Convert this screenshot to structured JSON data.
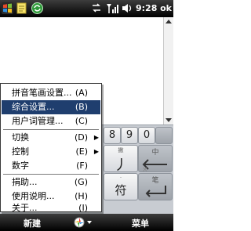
{
  "status_bar": {
    "time": "9:28",
    "ok_label": "ok",
    "icons": [
      "windows-start-icon",
      "notes-icon",
      "sync-icon",
      "connectivity-icon",
      "signal-icon",
      "volume-icon"
    ]
  },
  "keyboard": {
    "keys": [
      {
        "name": "key-8",
        "label": "8"
      },
      {
        "name": "key-9",
        "label": "9"
      },
      {
        "name": "key-0",
        "label": "0"
      },
      {
        "name": "key-ji",
        "label": "丿",
        "sub": "撇"
      },
      {
        "name": "key-fu",
        "label": "符"
      },
      {
        "name": "key-bi",
        "label": "笔"
      },
      {
        "name": "key-zhong",
        "label": "中"
      }
    ]
  },
  "menu": {
    "items": [
      {
        "label": "拼音笔画设置...",
        "accel": "(A)"
      },
      {
        "label": "综合设置...",
        "accel": "(B)",
        "selected": true
      },
      {
        "label": "用户词管理...",
        "accel": "(C)"
      },
      {
        "label": "切换",
        "accel": "(D)",
        "submenu": true
      },
      {
        "label": "控制",
        "accel": "(E)",
        "submenu": true
      },
      {
        "label": "数字",
        "accel": "(F)"
      },
      {
        "label": "捐助...",
        "accel": "(G)"
      },
      {
        "label": "使用说明...",
        "accel": "(H)"
      },
      {
        "label": "关于...",
        "accel": "(I)"
      }
    ]
  },
  "softkeys": {
    "left": "新建",
    "right": "菜单"
  },
  "colors": {
    "menu_highlight": "#1f3e6e",
    "bar_dark": "#000000",
    "keyboard_bg": "#c8ccd2"
  }
}
